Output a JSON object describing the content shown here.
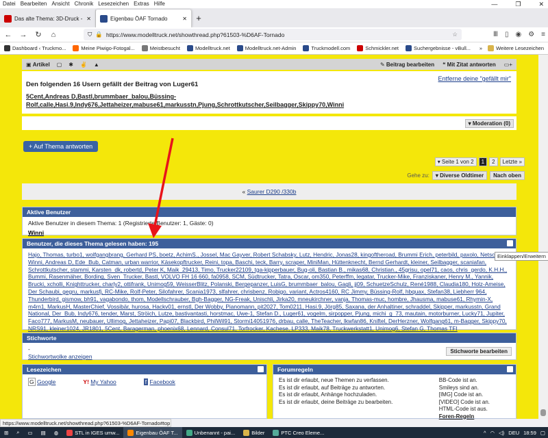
{
  "menubar": {
    "items": [
      "Datei",
      "Bearbeiten",
      "Ansicht",
      "Chronik",
      "Lesezeichen",
      "Extras",
      "Hilfe"
    ]
  },
  "window": {
    "minimize": "—",
    "maximize": "❐",
    "close": "✕"
  },
  "tabs": [
    {
      "label": "Das alte Thema: 3D-Druck - Flu",
      "close": "✕"
    },
    {
      "label": "Eigenbau ÖAF Tornado",
      "close": "✕"
    }
  ],
  "newtab": "+",
  "nav": {
    "url": "https://www.modelltruck.net/showthread.php?61503-%D6AF-Tornado"
  },
  "bookmarks": {
    "items": [
      "Dashboard ‹ Truckmo...",
      "Meine Piwigo-Fotogal...",
      "Meistbesucht",
      "Modelltruck.net",
      "Modelltruck.net-Admin",
      "Truckmodell.com",
      "Schmickler.net",
      "Suchergebnisse - vBull..."
    ],
    "more": "»",
    "other": "Weitere Lesezeichen"
  },
  "postbar": {
    "article": "Artikel",
    "edit": "Beitrag bearbeiten",
    "quote": "Mit Zitat antworten"
  },
  "thanks": {
    "title": "Den folgenden 16 Usern gefällt der Beitrag von Luger61",
    "remove": "Entferne deine \"gefällt mir\"",
    "line1": "5Cent,Andreas D,Bastl,brummbaer_balou,Büssing-",
    "line2": "Rolf,calle,Hasi.9,Indy676,Jettaheizer,mabuse61,markusstn,Pjung,Schrottkutscher,Seilbagger,Skippy70,Winni"
  },
  "moderation": "▾ Moderation (0)",
  "reply": "+ Auf Thema antworten",
  "pagenav": {
    "label": "▾ Seite 1 von 2",
    "p1": "1",
    "p2": "2",
    "last": "Letzte »"
  },
  "gohere": {
    "label": "Gehe zu:",
    "select": "▾ Diverse Oldtimer",
    "next": "Nach oben"
  },
  "prev": {
    "prefix": "« ",
    "link": "Saurer D290 /330b"
  },
  "active": {
    "head": "Aktive Benutzer",
    "text": "Aktive Benutzer in diesem Thema: 1 (Registrierte Benutzer: 1, Gäste: 0)",
    "user": "Winni"
  },
  "readers": {
    "head": "Benutzer, die dieses Thema gelesen haben: 195",
    "tooltip": "Einklappen/Erweitern",
    "text": "Hajo, Thomas, turbo1, wolfgangbrang, Gerhard PS, boetz, AchimS., Jossel, Mac Gayver, Robert Schabsky, Lutz, Hendric, Jonas28, kingoftheroad, Brummi Erich, peterbild, paxolo, Netsch, Winni, Andreas D, Ede_Bub, Catman, urban warrior, Käsekopftrucker, Reini, topa, Baschi, teck, Barry, scraper, MiniMan, Hüttenknecht, Bernd Gerhardt, kleiner, Seilbagger, scaniafan, Schrottkutscher, stammi, Karsten_dk, robertd, Peter K, Maik_29413, Timo, Trucker22109, tga-kipperbauer, Bug-oli, Bastian B., mikas68, Christian., 45grisu, opel71, caos, chris_gerdo, K.H.H., Bummi, Rasenmäher, Bording, Sven_Trucker, Bastl, VOLVO FH 16 660, fa0958, SCM, Südtrucker, Tatra, Oscar, om350, Peterffm, legatar, Trucker-Mike, Franziskaner, Henry M., Yannik, Brucki, xcholli, Knighttrucker, charly2, ottifrank, Unimog59, WeisserBlitz, Polanski, Bergepanzer, LuisG, brummbaer_balou, Gagli, jj09, SchuetzeSchulz, René1988, Claudia180, Holz-Ameise, Der Schaubi, gegru, markusfj, RC-Mike, Rolf-Peter, Silofahrer, Scania1973, slfahrer, chrisbenz, Robigo, variant, Actros4160, RC Jimmy, Büssing-Rolf, hbquax, Stefan38, Liebherr 964, Thunderbird, gismow, bh91, vagabondo, thom, Modellschrauber, Bgh-Bagger, NG-Freak, Unischli, Jirka20, mneukirchner, vanja, Thomas-muc, hombre, Jhausma, mabuse61, Rhymin-X, m4rn1, MarkusH, MasterChief, Vossibär, hurosa, Hackv01, ernstl, Der Wobby, Pianomann, pit2027, Tom0211, Hasi.9, Jörg85, Saxana, der Anhaltiner, schraddel, Skipper, markusstn, Grand National, Der_Bub, Indy676, tender, Marst, Ströich, Lutze, bastivantasti, horstmac, Uwe-1, Stefan D., Luger61, vogelm, sirpopper, Pjung, michi_g_73, mautain, motorburner, Lucky71, Jupiter, Faco777, MarkusM, neubauer, Ullimog, Jettaheizer, Papi07, Blackbird, PhilWil91, Stormi14051976, drbau, calle, TheTeacher, lkwfan86, Kniftel, DerHerzner, Wolfgang61, m-Bagger, Skippy70, NRS91, kleiner1024, JR1801, 5Cent, Baragerman, phoenix68, Lennard, Consul71, Torfrocker, Kachese, LP333, Maik78, Truckwerkstatt1, Unimog6, Stefan G, Thomas TFI"
  },
  "tags": {
    "head": "Stichworte",
    "dash": "-",
    "link": "Stichwortwolke anzeigen",
    "edit": "Stichworte bearbeiten"
  },
  "bookmarkbox": {
    "head": "Lesezeichen",
    "google": "Google",
    "yahoo": "My Yahoo",
    "facebook": "Facebook"
  },
  "rules": {
    "head": "Forumregeln",
    "r1": "Es ist dir erlaubt, neue Themen zu verfassen.",
    "r2": "Es ist dir erlaubt, auf Beiträge zu antworten.",
    "r3": "Es ist dir erlaubt, Anhänge hochzuladen.",
    "r4": "Es ist dir erlaubt, deine Beiträge zu bearbeiten.",
    "c1": "BB-Code ist an.",
    "c2": "Smileys sind an.",
    "c3": "[IMG] Code ist an.",
    "c4": "[VIDEO] Code ist an.",
    "c5": "HTML-Code ist aus.",
    "c6": "Foren-Regeln"
  },
  "status": "https://www.modelltruck.net/showthread.php?61503-%D6AF-Tornado#top",
  "taskbar": {
    "items": [
      "STL in IGES umw...",
      "Eigenbau ÖAF T...",
      "Unbenannt - pai...",
      "Bilder",
      "PTC Creo Eleme..."
    ],
    "lang": "DEU",
    "time": "18:59"
  },
  "colors": {
    "accent": "#3d5f9b",
    "page_bg": "#f4e70a",
    "arrow": "#e8141a"
  }
}
